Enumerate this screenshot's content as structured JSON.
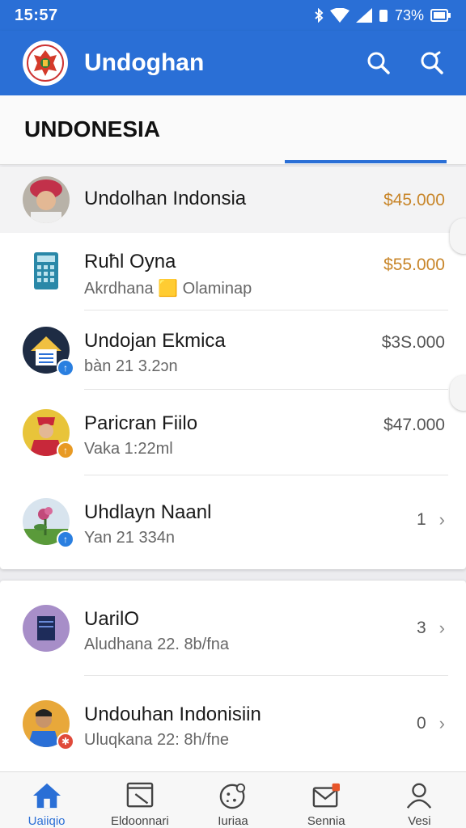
{
  "status_bar": {
    "time": "15:57",
    "battery": "73%"
  },
  "app_bar": {
    "title": "Undoghan"
  },
  "tab": {
    "title": "UNDONESIA"
  },
  "list": [
    {
      "name": "Undolhan Indonsia",
      "sub": "",
      "trail": "$45.000"
    },
    {
      "name": "Ruħl Oyna",
      "sub": "Akrdhana 🟨 Olaminap",
      "trail": "$55.000"
    },
    {
      "name": "Undojan Ekmica",
      "sub": "bàn 21 3.2ɔn",
      "trail": "$3S.000"
    },
    {
      "name": "Paricran Fiilo",
      "sub": "Vaka 1:22ml",
      "trail": "$47.000"
    },
    {
      "name": "Uhdlayn Naanl",
      "sub": "Yan 21 334n",
      "trail": "1"
    }
  ],
  "list2": [
    {
      "name": "UarilO",
      "sub": "Aludhana 22. 8b/fna",
      "trail": "3"
    },
    {
      "name": "Undouhan Indonisiin",
      "sub": "Uluqkana 22: 8h/fne",
      "trail": "0"
    }
  ],
  "bottom_nav": [
    {
      "label": "Uaiiqio"
    },
    {
      "label": "Eldoonnari"
    },
    {
      "label": "Iuriaa"
    },
    {
      "label": "Sennia"
    },
    {
      "label": "Vesi"
    }
  ],
  "colors": {
    "primary": "#2a6fd6",
    "price": "#c8862a"
  }
}
